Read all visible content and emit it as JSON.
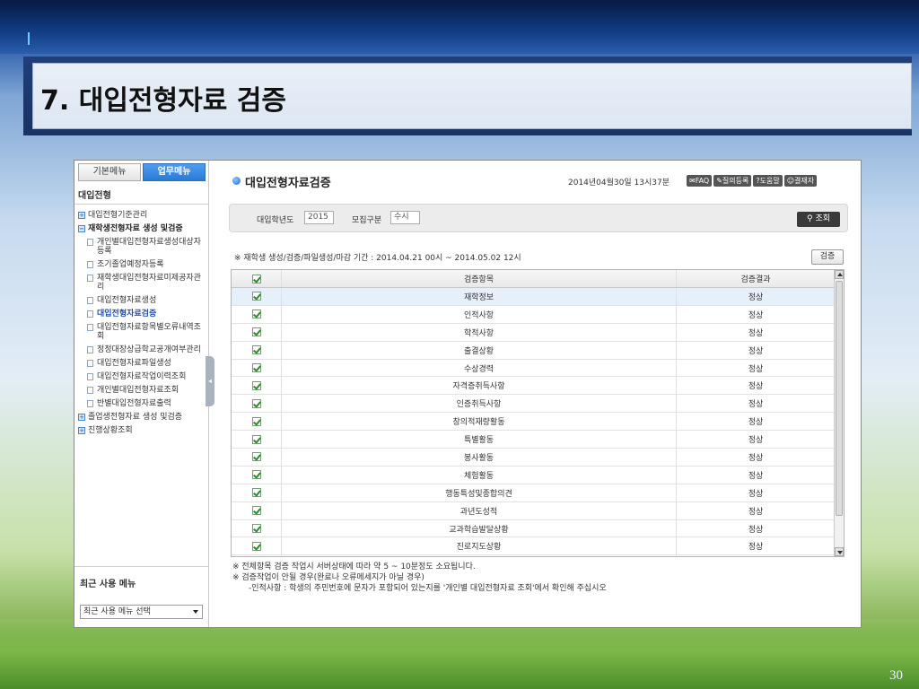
{
  "slide": {
    "title": "7. 대입전형자료 검증",
    "number": "30"
  },
  "sidebar": {
    "tabs": [
      {
        "label": "기본메뉴"
      },
      {
        "label": "업무메뉴"
      }
    ],
    "heading": "대입전형",
    "menu": [
      {
        "label": "대입전형기준관리",
        "level": 0,
        "icon": "plus"
      },
      {
        "label": "재학생전형자료 생성 및검증",
        "level": 0,
        "icon": "minus"
      },
      {
        "label": "개인별대입전형자료생성대상자등록",
        "level": 1
      },
      {
        "label": "조기졸업예정자등록",
        "level": 1
      },
      {
        "label": "재학생대입전형자료미제공자관리",
        "level": 1
      },
      {
        "label": "대입전형자료생성",
        "level": 1
      },
      {
        "label": "대입전형자료검증",
        "level": 1
      },
      {
        "label": "대입전형자료항목별오류내역조회",
        "level": 1
      },
      {
        "label": "정정대장상급학교공개여부관리",
        "level": 1
      },
      {
        "label": "대입전형자료파일생성",
        "level": 1
      },
      {
        "label": "대입전형자료작업이력조회",
        "level": 1
      },
      {
        "label": "개인별대입전형자료조회",
        "level": 1
      },
      {
        "label": "반별대입전형자료출력",
        "level": 1
      },
      {
        "label": "졸업생전형자료 생성 및검증",
        "level": 0,
        "icon": "plus"
      },
      {
        "label": "진행상황조회",
        "level": 0,
        "icon": "plus"
      }
    ],
    "recent_title": "최근 사용 메뉴",
    "recent_select": "최근 사용 메뉴 선택"
  },
  "main": {
    "title": "대입전형자료검증",
    "datetime": "2014년04월30일 13시37분",
    "toolbar": [
      "FAQ",
      "질의등록",
      "도움말",
      "결재자"
    ],
    "filter": {
      "year_label": "대입학년도",
      "year_value": "2015",
      "type_label": "모집구분",
      "type_value": "수시",
      "search_label": "조회"
    },
    "period_text": "※ 재학생 생성/검증/파일생성/마감 기간 :  2014.04.21  00시 ~ 2014.05.02  12시",
    "verify_label": "검증",
    "grid": {
      "headers": [
        "",
        "검증항목",
        "검증결과"
      ],
      "rows": [
        {
          "item": "재학정보",
          "result": "정상"
        },
        {
          "item": "인적사항",
          "result": "정상"
        },
        {
          "item": "학적사항",
          "result": "정상"
        },
        {
          "item": "출결상황",
          "result": "정상"
        },
        {
          "item": "수상경력",
          "result": "정상"
        },
        {
          "item": "자격증취득사항",
          "result": "정상"
        },
        {
          "item": "인증취득사항",
          "result": "정상"
        },
        {
          "item": "창의적재량활동",
          "result": "정상"
        },
        {
          "item": "특별활동",
          "result": "정상"
        },
        {
          "item": "봉사활동",
          "result": "정상"
        },
        {
          "item": "체험활동",
          "result": "정상"
        },
        {
          "item": "행동특성및종합의견",
          "result": "정상"
        },
        {
          "item": "과년도성적",
          "result": "정상"
        },
        {
          "item": "교과학습발달상황",
          "result": "정상"
        },
        {
          "item": "진로지도상황",
          "result": "정상"
        }
      ]
    },
    "notes": [
      "※ 전체항목 검증 작업시 서버상태에 따라 약 5 ~ 10분정도 소요됩니다.",
      "※ 검증작업이 안될 경우(완료나 오류메세지가 아닐 경우)",
      "-인적사항 : 학생의 주민번호에 문자가 포함되어 있는지를 '개인별 대입전형자료 조회'에서 확인해 주십시오"
    ]
  }
}
